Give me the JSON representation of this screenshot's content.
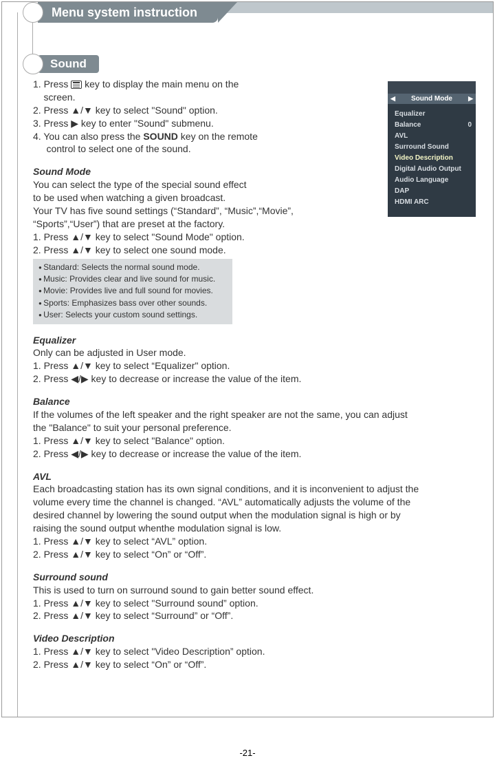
{
  "header": {
    "title": "Menu system instruction"
  },
  "section": {
    "title": "Sound"
  },
  "intro": {
    "s1a": "1. Press ",
    "s1b": " key to display the main menu on the",
    "s1c": "    screen.",
    "s2": "2. Press ▲/▼ key to select \"Sound\" option.",
    "s3": "3. Press ▶ key to enter \"Sound\" submenu.",
    "s4a": "4. You can also press the ",
    "s4bold": "SOUND",
    "s4b": " key on the remote",
    "s4c": "     control to select one of the sound."
  },
  "soundmode": {
    "h": "Sound Mode",
    "p1": "You can select the type of the special sound effect",
    "p2": "to be used when watching a given broadcast.",
    "p3": "Your TV has five sound settings (“Standard”, “Music”,“Movie”,",
    "p4": "“Sports”,“User”) that are preset at the factory.",
    "p5": "1. Press ▲/▼ key to select \"Sound Mode\" option.",
    "p6": "2. Press ▲/▼ key to select one sound mode."
  },
  "modes": {
    "m1": "Standard: Selects the normal sound mode.",
    "m2": "Music: Provides clear and live sound for music.",
    "m3": "Movie: Provides live and full sound for movies.",
    "m4": "Sports: Emphasizes bass over other sounds.",
    "m5": "User: Selects your custom sound settings."
  },
  "equalizer": {
    "h": "Equalizer",
    "p1": "Only can be adjusted in User mode.",
    "p2": "1. Press ▲/▼ key to select “Equalizer\" option.",
    "p3": "2. Press ◀/▶ key to decrease or increase the value of the item."
  },
  "balance": {
    "h": "Balance",
    "p1": "If the volumes of the left speaker and the right speaker are not the same, you can adjust",
    "p2": "the \"Balance\" to suit your personal preference.",
    "p3": "1. Press ▲/▼ key to select \"Balance\" option.",
    "p4": "2. Press ◀/▶ key to decrease or increase the value of the item."
  },
  "avl": {
    "h": "AVL",
    "p1": "Each broadcasting station has its own signal conditions, and it is inconvenient to adjust the",
    "p2": "volume every time the channel is changed. “AVL” automatically adjusts the volume of the",
    "p3": "desired channel by lowering the sound output when the modulation signal is high or by",
    "p4": "raising the sound output whenthe modulation signal is low.",
    "p5": "1. Press ▲/▼ key to select “AVL” option.",
    "p6": "2. Press ▲/▼ key to select  “On” or “Off”."
  },
  "surround": {
    "h": "Surround sound",
    "p1": "This is used to turn on surround sound to gain better sound effect.",
    "p2": "1. Press ▲/▼ key to select \"Surround sound” option.",
    "p3": "2. Press ▲/▼ key to select  “Surround” or “Off”."
  },
  "videodesc": {
    "h": "Video  Description",
    "p1": "1. Press ▲/▼ key to select \"Video  Description” option.",
    "p2": "2. Press ▲/▼ key to select  “On” or “Off”."
  },
  "osd": {
    "header": "Sound Mode",
    "items": [
      {
        "label": "Equalizer",
        "value": ""
      },
      {
        "label": "Balance",
        "value": "0"
      },
      {
        "label": "AVL",
        "value": ""
      },
      {
        "label": "Surround Sound",
        "value": ""
      },
      {
        "label": "Video  Description",
        "value": "",
        "hl": true
      },
      {
        "label": "Digital Audio Output",
        "value": ""
      },
      {
        "label": "Audio Language",
        "value": ""
      },
      {
        "label": "DAP",
        "value": ""
      },
      {
        "label": "HDMI ARC",
        "value": ""
      }
    ]
  },
  "page_number": "-21-"
}
